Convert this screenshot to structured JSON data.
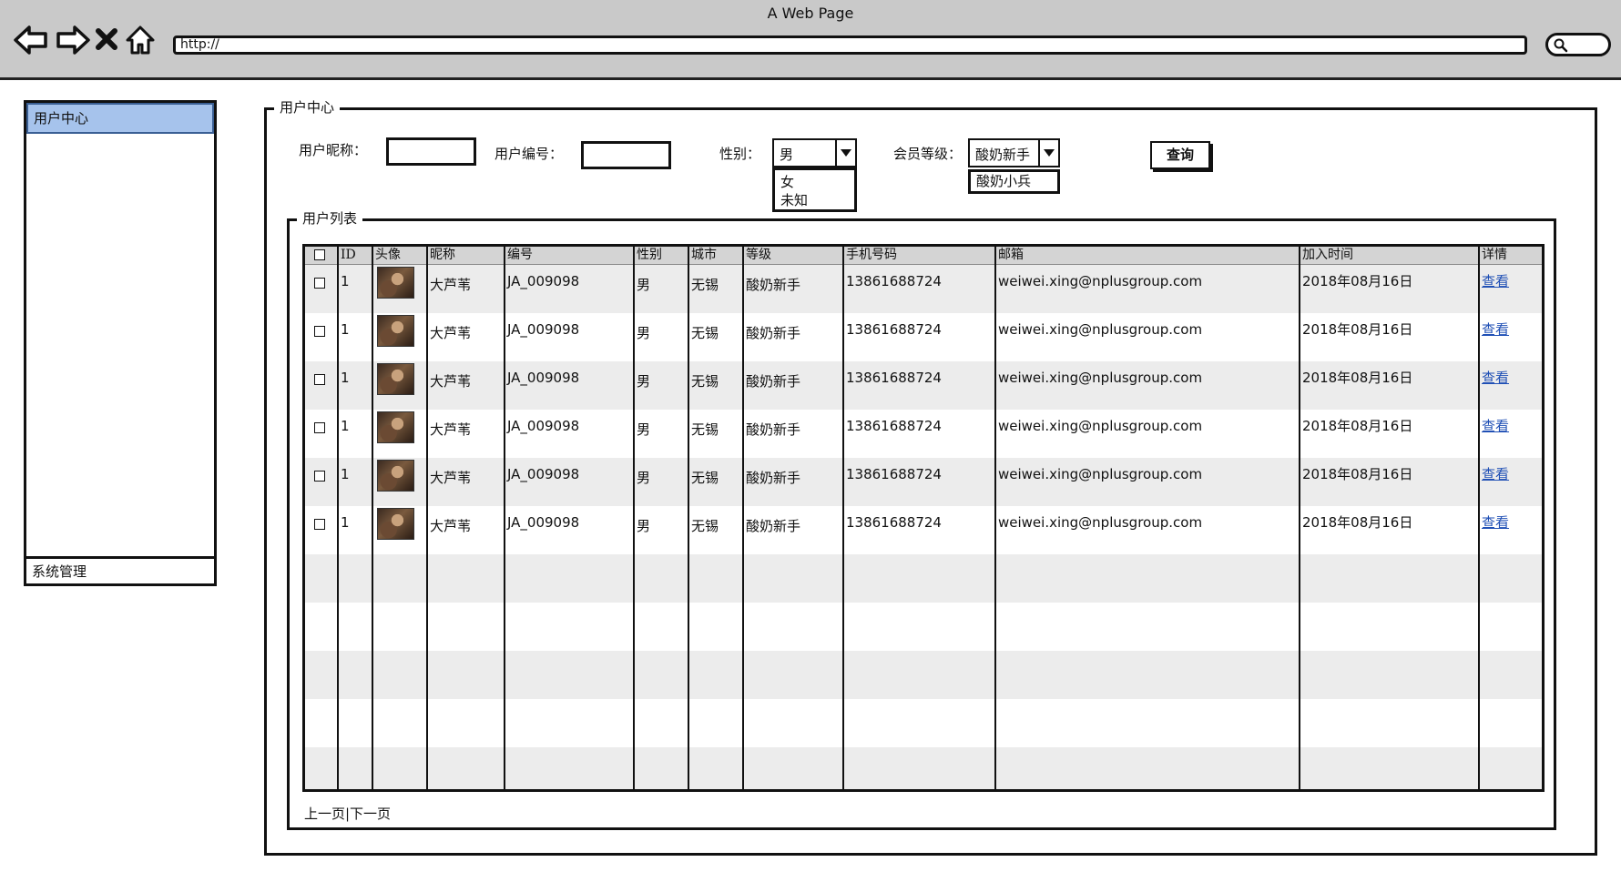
{
  "browser": {
    "title": "A Web Page",
    "url": "http://"
  },
  "sidebar": {
    "items": [
      {
        "label": "用户中心",
        "active": true
      },
      {
        "label": "系统管理",
        "active": false
      }
    ]
  },
  "user_center": {
    "legend": "用户中心",
    "filters": {
      "nickname_label": "用户昵称：",
      "nickname_value": "",
      "user_no_label": "用户编号：",
      "user_no_value": "",
      "gender_label": "性别：",
      "gender_selected": "男",
      "gender_options_open": [
        "女",
        "未知"
      ],
      "level_label": "会员等级：",
      "level_selected": "酸奶新手",
      "level_options_open": [
        "酸奶小兵"
      ],
      "query_button": "查询"
    }
  },
  "user_list": {
    "legend": "用户列表",
    "columns": [
      "ID",
      "头像",
      "昵称",
      "编号",
      "性别",
      "城市",
      "等级",
      "手机号码",
      "邮箱",
      "加入时间",
      "详情"
    ],
    "rows": [
      {
        "id": "1",
        "nickname": "大芦苇",
        "number": "JA_009098",
        "gender": "男",
        "city": "无锡",
        "level": "酸奶新手",
        "phone": "13861688724",
        "email": "weiwei.xing@nplusgroup.com",
        "joined": "2018年08月16日",
        "detail": "查看"
      },
      {
        "id": "1",
        "nickname": "大芦苇",
        "number": "JA_009098",
        "gender": "男",
        "city": "无锡",
        "level": "酸奶新手",
        "phone": "13861688724",
        "email": "weiwei.xing@nplusgroup.com",
        "joined": "2018年08月16日",
        "detail": "查看"
      },
      {
        "id": "1",
        "nickname": "大芦苇",
        "number": "JA_009098",
        "gender": "男",
        "city": "无锡",
        "level": "酸奶新手",
        "phone": "13861688724",
        "email": "weiwei.xing@nplusgroup.com",
        "joined": "2018年08月16日",
        "detail": "查看"
      },
      {
        "id": "1",
        "nickname": "大芦苇",
        "number": "JA_009098",
        "gender": "男",
        "city": "无锡",
        "level": "酸奶新手",
        "phone": "13861688724",
        "email": "weiwei.xing@nplusgroup.com",
        "joined": "2018年08月16日",
        "detail": "查看"
      },
      {
        "id": "1",
        "nickname": "大芦苇",
        "number": "JA_009098",
        "gender": "男",
        "city": "无锡",
        "level": "酸奶新手",
        "phone": "13861688724",
        "email": "weiwei.xing@nplusgroup.com",
        "joined": "2018年08月16日",
        "detail": "查看"
      },
      {
        "id": "1",
        "nickname": "大芦苇",
        "number": "JA_009098",
        "gender": "男",
        "city": "无锡",
        "level": "酸奶新手",
        "phone": "13861688724",
        "email": "weiwei.xing@nplusgroup.com",
        "joined": "2018年08月16日",
        "detail": "查看"
      }
    ],
    "pager": "上一页|下一页"
  },
  "icons": {
    "back": "back-arrow-icon",
    "forward": "forward-arrow-icon",
    "stop": "close-x-icon",
    "home": "home-icon",
    "search": "search-icon",
    "avatar": "user-avatar-image"
  },
  "colors": {
    "chrome": "#c9c9c9",
    "active_nav": "#a6c3ec",
    "header_row": "#d4d4d4",
    "stripe": "#ececec",
    "link": "#1f4fb5"
  }
}
